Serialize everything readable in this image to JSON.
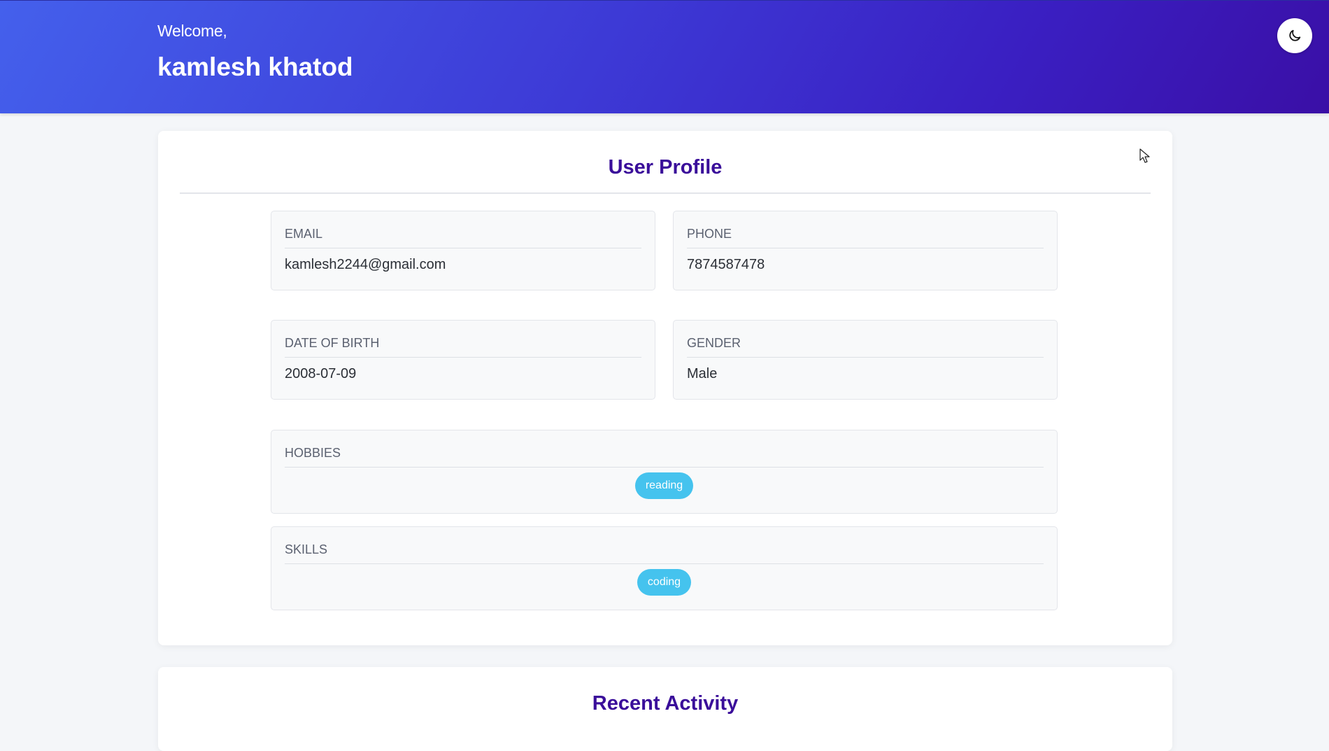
{
  "header": {
    "welcome_text": "Welcome,",
    "user_name": "kamlesh khatod",
    "theme_toggle_icon": "moon-icon"
  },
  "profile": {
    "title": "User Profile",
    "fields": {
      "email": {
        "label": "EMAIL",
        "value": "kamlesh2244@gmail.com"
      },
      "phone": {
        "label": "PHONE",
        "value": "7874587478"
      },
      "dob": {
        "label": "DATE OF BIRTH",
        "value": "2008-07-09"
      },
      "gender": {
        "label": "GENDER",
        "value": "Male"
      }
    },
    "hobbies": {
      "label": "HOBBIES",
      "items": [
        "reading"
      ]
    },
    "skills": {
      "label": "SKILLS",
      "items": [
        "coding"
      ]
    }
  },
  "activity": {
    "title": "Recent Activity"
  },
  "colors": {
    "header_gradient_start": "#4460ec",
    "header_gradient_end": "#3a0fa6",
    "title_color": "#3a0e9a",
    "chip_color": "#45c3ee",
    "page_background": "#f4f6f9"
  }
}
